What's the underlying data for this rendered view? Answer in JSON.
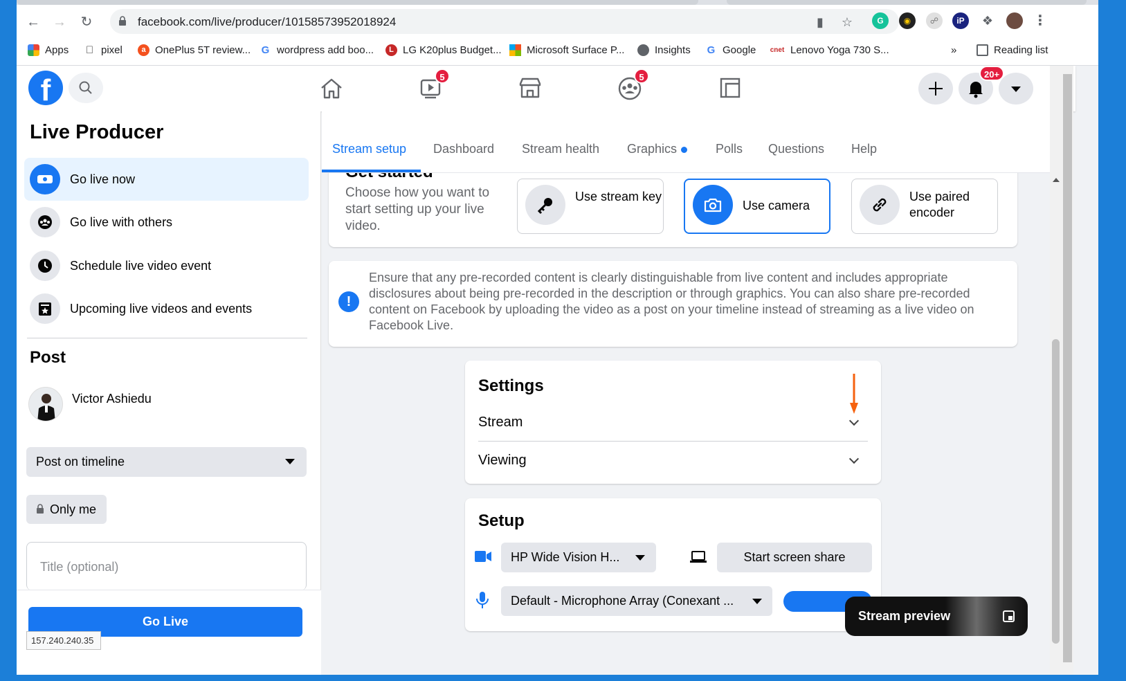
{
  "browser": {
    "url": "facebook.com/live/producer/10158573952018924",
    "bookmarks": [
      "Apps",
      "pixel",
      "OnePlus 5T review...",
      "wordpress add boo...",
      "LG K20plus Budget...",
      "Microsoft Surface P...",
      "Insights",
      "Google",
      "Lenovo Yoga 730 S..."
    ],
    "more_bookmarks": "»",
    "reading_list": "Reading list"
  },
  "facebook": {
    "logo": "f",
    "badges": {
      "watch": "5",
      "groups": "5",
      "notifications": "20+"
    }
  },
  "sidebar": {
    "title": "Live Producer",
    "items": [
      {
        "label": "Go live now",
        "active": true
      },
      {
        "label": "Go live with others",
        "active": false
      },
      {
        "label": "Schedule live video event",
        "active": false
      },
      {
        "label": "Upcoming live videos and events",
        "active": false
      }
    ],
    "post_heading": "Post",
    "user_name": "Victor Ashiedu",
    "post_target": "Post on timeline",
    "privacy": "Only me",
    "title_placeholder": "Title (optional)",
    "go_live_label": "Go Live",
    "status_ip": "157.240.240.35"
  },
  "tabs": [
    {
      "label": "Stream setup",
      "active": true
    },
    {
      "label": "Dashboard"
    },
    {
      "label": "Stream health"
    },
    {
      "label": "Graphics"
    },
    {
      "label": "Polls"
    },
    {
      "label": "Questions"
    },
    {
      "label": "Help"
    }
  ],
  "get_started": {
    "title": "Get started",
    "description": "Choose how you want to start setting up your live video.",
    "options": [
      {
        "label": "Use stream key",
        "selected": false
      },
      {
        "label": "Use camera",
        "selected": true
      },
      {
        "label": "Use paired encoder",
        "selected": false
      }
    ]
  },
  "notice": "Ensure that any pre-recorded content is clearly distinguishable from live content and includes appropriate disclosures about being pre-recorded in the description or through graphics. You can also share pre-recorded content on Facebook by uploading the video as a post on your timeline instead of streaming as a live video on Facebook Live.",
  "settings": {
    "title": "Settings",
    "rows": [
      "Stream",
      "Viewing"
    ]
  },
  "setup": {
    "title": "Setup",
    "camera": "HP Wide Vision H...",
    "screen_share": "Start screen share",
    "microphone": "Default - Microphone Array (Conexant ..."
  },
  "preview": {
    "label": "Stream preview"
  },
  "colors": {
    "fb_blue": "#1877f2",
    "badge_red": "#e41e3f",
    "arrow_orange": "#f5620f"
  }
}
